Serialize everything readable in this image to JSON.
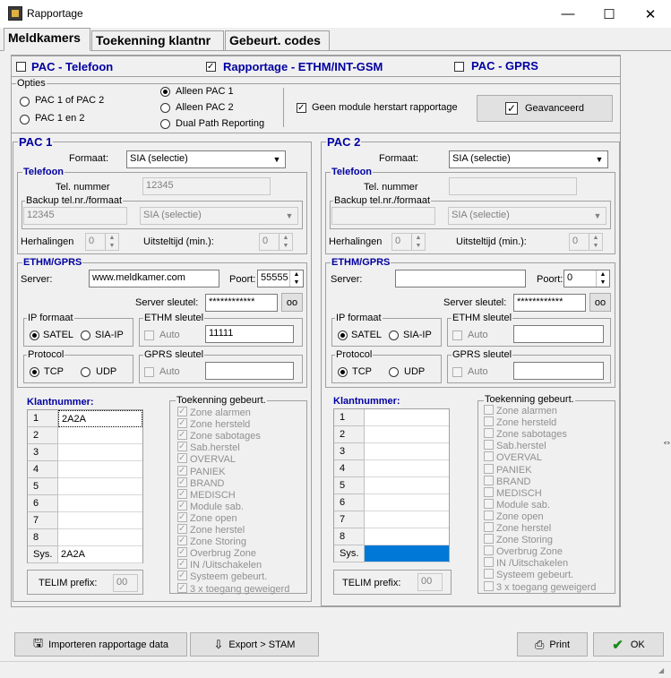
{
  "window": {
    "title": "Rapportage",
    "minimize": "—",
    "maximize": "☐",
    "close": "✕"
  },
  "tabs": [
    "Meldkamers",
    "Toekenning klantnr",
    "Gebeurt. codes"
  ],
  "top_options": {
    "pac_telefoon": {
      "label": "PAC - Telefoon",
      "checked": false
    },
    "rapportage_ethm": {
      "label": "Rapportage - ETHM/INT-GSM",
      "checked": true
    },
    "pac_gprs": {
      "label": "PAC - GPRS",
      "checked": false
    }
  },
  "opties": {
    "legend": "Opties",
    "radio1": "PAC 1 of PAC 2",
    "radio2": "PAC 1 en 2",
    "radio3": "Alleen PAC 1",
    "radio4": "Alleen PAC 2",
    "radio5": "Dual Path Reporting",
    "geen_module": "Geen module herstart rapportage",
    "geavanceerd": "Geavanceerd"
  },
  "pac1": {
    "title": "PAC 1",
    "formaat_label": "Formaat:",
    "formaat_value": "SIA (selectie)",
    "telefoon_legend": "Telefoon",
    "telnr_label": "Tel. nummer",
    "telnr_value": "12345",
    "backup_legend": "Backup tel.nr./formaat",
    "backup_value": "12345",
    "backup_format": "SIA (selectie)",
    "herhalingen_label": "Herhalingen",
    "herhalingen_value": "0",
    "uitstel_label": "Uitsteltijd (min.):",
    "uitstel_value": "0",
    "ethm_legend": "ETHM/GPRS",
    "server_label": "Server:",
    "server_value": "www.meldkamer.com",
    "poort_label": "Poort:",
    "poort_value": "55555",
    "serverkey_label": "Server sleutel:",
    "serverkey_value": "************",
    "ipformat_legend": "IP formaat",
    "satel": "SATEL",
    "siaip": "SIA-IP",
    "ethmkey_legend": "ETHM sleutel",
    "auto": "Auto",
    "ethmkey_value": "11111",
    "protocol_legend": "Protocol",
    "tcp": "TCP",
    "udp": "UDP",
    "gprskey_legend": "GPRS sleutel",
    "klant_label": "Klantnummer:",
    "klant_rows": [
      {
        "label": "1",
        "value": "2A2A"
      },
      {
        "label": "2",
        "value": ""
      },
      {
        "label": "3",
        "value": ""
      },
      {
        "label": "4",
        "value": ""
      },
      {
        "label": "5",
        "value": ""
      },
      {
        "label": "6",
        "value": ""
      },
      {
        "label": "7",
        "value": ""
      },
      {
        "label": "8",
        "value": ""
      },
      {
        "label": "Sys.",
        "value": "2A2A"
      }
    ],
    "telim_label": "TELIM prefix:",
    "telim_value": "00",
    "toek_legend": "Toekenning gebeurt."
  },
  "pac2": {
    "title": "PAC 2",
    "formaat_label": "Formaat:",
    "formaat_value": "SIA (selectie)",
    "telefoon_legend": "Telefoon",
    "telnr_label": "Tel. nummer",
    "telnr_value": "",
    "backup_legend": "Backup tel.nr./formaat",
    "backup_value": "",
    "backup_format": "SIA (selectie)",
    "herhalingen_label": "Herhalingen",
    "herhalingen_value": "0",
    "uitstel_label": "Uitsteltijd (min.):",
    "uitstel_value": "0",
    "ethm_legend": "ETHM/GPRS",
    "server_label": "Server:",
    "server_value": "",
    "poort_label": "Poort:",
    "poort_value": "0",
    "serverkey_label": "Server sleutel:",
    "serverkey_value": "************",
    "ipformat_legend": "IP formaat",
    "satel": "SATEL",
    "siaip": "SIA-IP",
    "ethmkey_legend": "ETHM sleutel",
    "auto": "Auto",
    "ethmkey_value": "",
    "protocol_legend": "Protocol",
    "tcp": "TCP",
    "udp": "UDP",
    "gprskey_legend": "GPRS sleutel",
    "klant_label": "Klantnummer:",
    "klant_rows": [
      {
        "label": "1",
        "value": ""
      },
      {
        "label": "2",
        "value": ""
      },
      {
        "label": "3",
        "value": ""
      },
      {
        "label": "4",
        "value": ""
      },
      {
        "label": "5",
        "value": ""
      },
      {
        "label": "6",
        "value": ""
      },
      {
        "label": "7",
        "value": ""
      },
      {
        "label": "8",
        "value": ""
      },
      {
        "label": "Sys.",
        "value": ""
      }
    ],
    "telim_label": "TELIM prefix:",
    "telim_value": "00",
    "toek_legend": "Toekenning gebeurt."
  },
  "events": [
    "Zone alarmen",
    "Zone hersteld",
    "Zone sabotages",
    "Sab.herstel",
    "OVERVAL",
    "PANIEK",
    "BRAND",
    "MEDISCH",
    "Module sab.",
    "Zone open",
    "Zone herstel",
    "Zone Storing",
    "Overbrug Zone",
    "IN /Uitschakelen",
    "Systeem gebeurt.",
    "3 x toegang geweigerd"
  ],
  "footer": {
    "import": "Importeren rapportage data",
    "export": "Export > STAM",
    "print": "Print",
    "ok": "OK"
  },
  "colors": {
    "accent_blue": "#0000a0",
    "selection": "#0078d7"
  }
}
